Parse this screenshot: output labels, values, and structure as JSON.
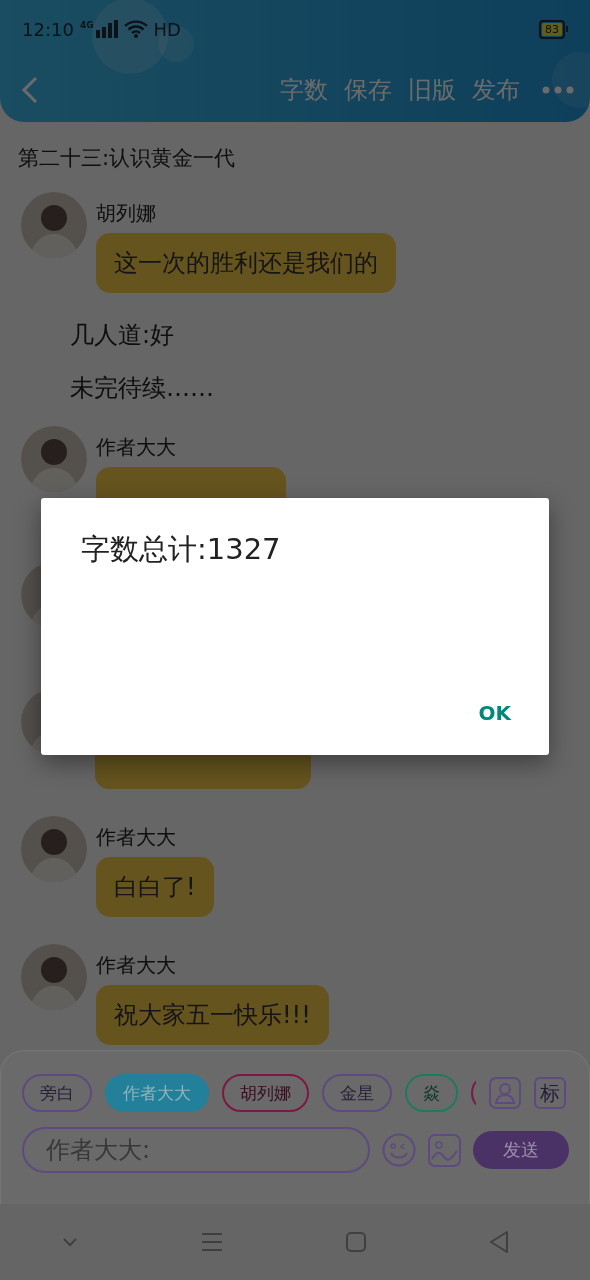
{
  "status_bar": {
    "time": "12:10",
    "network": "4G",
    "hd": "HD",
    "battery": "83"
  },
  "toolbar": {
    "actions": [
      "字数",
      "保存",
      "旧版",
      "发布"
    ]
  },
  "chapter_title": "第二十三:认识黄金一代",
  "messages": [
    {
      "kind": "chat",
      "speaker": "胡列娜",
      "text": "这一次的胜利还是我们的"
    },
    {
      "kind": "narration",
      "text": "几人道:好"
    },
    {
      "kind": "narration",
      "text": "未完待续……"
    },
    {
      "kind": "partial",
      "speaker": "作者大大"
    },
    {
      "kind": "covered"
    },
    {
      "kind": "covered"
    },
    {
      "kind": "chat",
      "speaker": "作者大大",
      "text": "白白了!"
    },
    {
      "kind": "chat",
      "speaker": "作者大大",
      "text": "祝大家五一快乐!!!"
    }
  ],
  "chips": [
    {
      "label": "旁白",
      "color": "#5e4a7e",
      "selected": false
    },
    {
      "label": "作者大大",
      "color": "#23809a",
      "selected": true
    },
    {
      "label": "胡列娜",
      "color": "#7d1745",
      "selected": false
    },
    {
      "label": "金星",
      "color": "#5e4a7e",
      "selected": false
    },
    {
      "label": "焱",
      "color": "#1d7a60",
      "selected": false
    },
    {
      "color": "#7d1745",
      "selected": false
    }
  ],
  "tag_button": "标",
  "input": {
    "placeholder": "作者大大:"
  },
  "send_button": "发送",
  "dialog": {
    "message": "字数总计:1327",
    "ok": "OK"
  }
}
